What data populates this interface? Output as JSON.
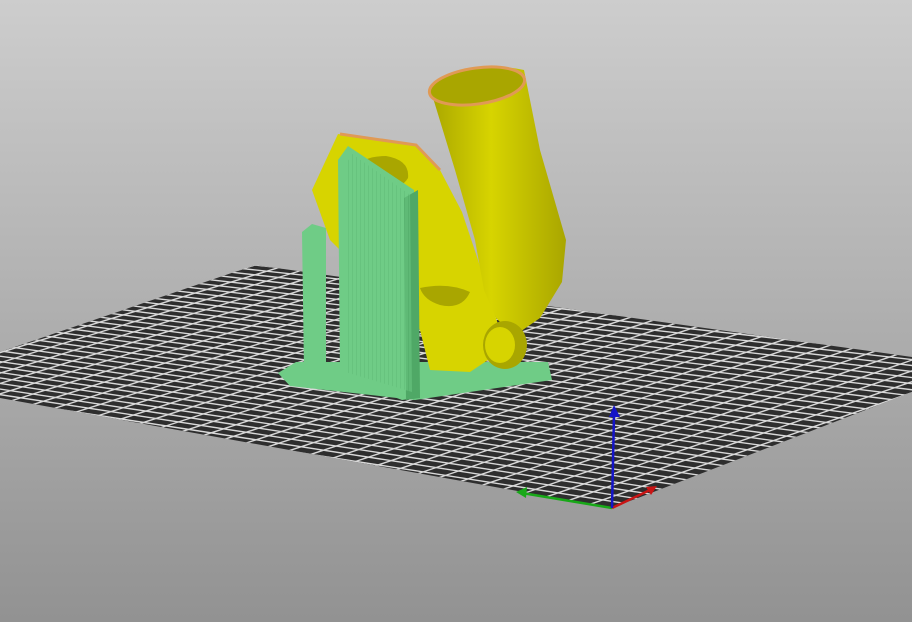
{
  "viewport": {
    "background_top": "#cdcdcd",
    "background_bottom": "#929292"
  },
  "bed": {
    "plate_color": "#2e2e2e",
    "grid_color": "#d9d9d9"
  },
  "model": {
    "part_color": "#d7d400",
    "part_shadow_color": "#a9a600",
    "support_color": "#6fcc86",
    "support_shadow_color": "#4fa866",
    "perimeter_color": "#e09a55"
  },
  "axes": {
    "x_color": "#c81414",
    "y_color": "#18a818",
    "z_color": "#1414c8"
  }
}
